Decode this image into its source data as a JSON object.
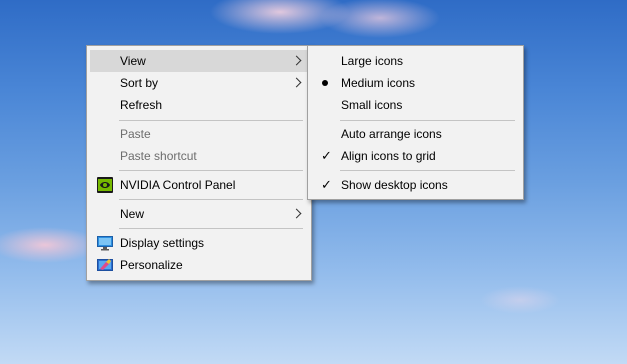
{
  "context_menu": {
    "items": [
      {
        "label": "View",
        "submenu": true,
        "highlighted": true
      },
      {
        "label": "Sort by",
        "submenu": true
      },
      {
        "label": "Refresh"
      },
      {
        "label": "Paste",
        "disabled": true
      },
      {
        "label": "Paste shortcut",
        "disabled": true
      },
      {
        "label": "NVIDIA Control Panel",
        "icon": "nvidia-icon"
      },
      {
        "label": "New",
        "submenu": true
      },
      {
        "label": "Display settings",
        "icon": "display-settings-icon"
      },
      {
        "label": "Personalize",
        "icon": "personalize-icon"
      }
    ]
  },
  "view_submenu": {
    "items": [
      {
        "label": "Large icons"
      },
      {
        "label": "Medium icons",
        "selected": true,
        "marker": "bullet"
      },
      {
        "label": "Small icons"
      },
      {
        "label": "Auto arrange icons"
      },
      {
        "label": "Align icons to grid",
        "checked": true
      },
      {
        "label": "Show desktop icons",
        "checked": true
      }
    ],
    "check_glyph": "✓"
  },
  "colors": {
    "menu_bg": "#f2f2f2",
    "highlight": "#d8d8d8",
    "disabled_text": "#6d6d6d",
    "nvidia_green": "#76b900"
  }
}
